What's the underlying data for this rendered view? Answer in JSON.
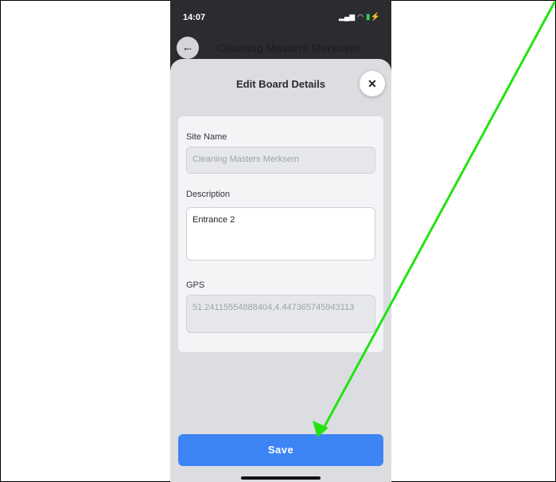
{
  "status_bar": {
    "time": "14:07",
    "signal": "▂▄▆",
    "wifi": "◠",
    "battery": "▮⚡"
  },
  "header": {
    "back_icon": "←",
    "title": "Cleaning Masters Merksem"
  },
  "sheet": {
    "title": "Edit Board Details",
    "close_icon": "✕"
  },
  "form": {
    "site_name_label": "Site Name",
    "site_name_value": "Cleaning Masters Merksem",
    "description_label": "Description",
    "description_value": "Entrance 2",
    "gps_label": "GPS",
    "gps_value": "51.24115554888404,4.447365745943113"
  },
  "save_label": "Save",
  "colors": {
    "accent": "#3d84f4",
    "annotation_arrow": "#22e312"
  }
}
